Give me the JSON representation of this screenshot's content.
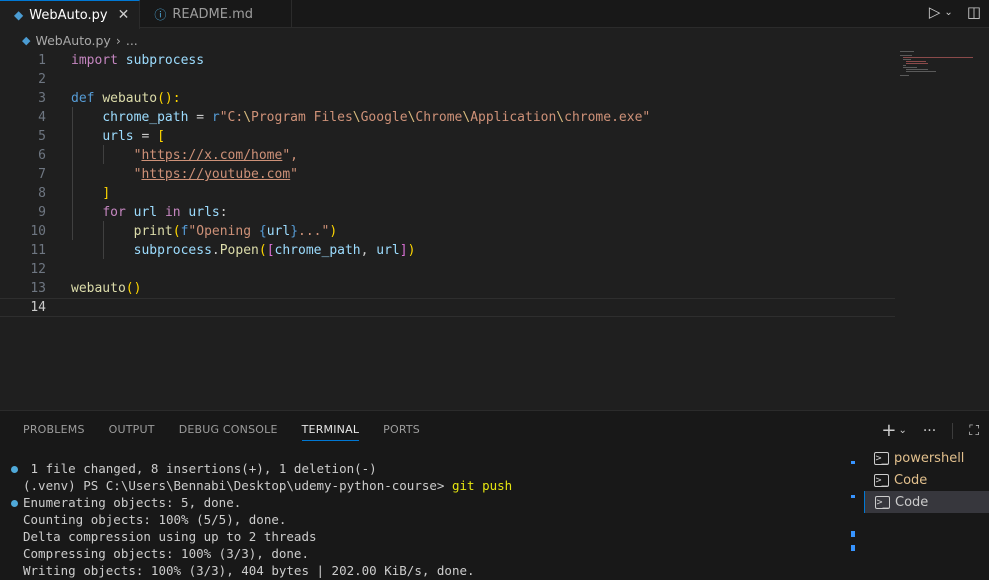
{
  "tabs": [
    {
      "label": "WebAuto.py",
      "active": true
    },
    {
      "label": "README.md",
      "active": false
    }
  ],
  "breadcrumb": {
    "file": "WebAuto.py",
    "more": "..."
  },
  "editor": {
    "current_line": 14,
    "line_numbers": [
      "1",
      "2",
      "3",
      "4",
      "5",
      "6",
      "7",
      "8",
      "9",
      "10",
      "11",
      "12",
      "13",
      "14"
    ]
  },
  "code": {
    "l1_import": "import",
    "l1_module": "subprocess",
    "l3_def": "def",
    "l3_name": "webauto",
    "l3_paren": "():",
    "l4_var": "chrome_path",
    "l4_eq": " = ",
    "l4_prefix": "r",
    "l4_q1": "\"C:",
    "l4_e1": "\\",
    "l4_p1": "Program Files",
    "l4_e2": "\\",
    "l4_p2": "Google",
    "l4_e3": "\\",
    "l4_p3": "Chrome",
    "l4_e4": "\\",
    "l4_p4": "Application",
    "l4_e5": "\\",
    "l4_p5": "chrome.exe\"",
    "l5_var": "urls",
    "l5_eq": " = ",
    "l5_open": "[",
    "l6_q": "\"",
    "l6_url": "https://x.com/home",
    "l6_end": "\",",
    "l7_q": "\"",
    "l7_url": "https://youtube.com",
    "l7_end": "\"",
    "l8_close": "]",
    "l9_for": "for",
    "l9_url": " url ",
    "l9_in": "in",
    "l9_urls": " urls",
    "l9_colon": ":",
    "l10_print": "print",
    "l10_open": "(",
    "l10_f": "f",
    "l10_s1": "\"Opening ",
    "l10_b1": "{",
    "l10_v": "url",
    "l10_b2": "}",
    "l10_s2": "...\"",
    "l10_close": ")",
    "l11_mod": "subprocess",
    "l11_dot": ".",
    "l11_fn": "Popen",
    "l11_open": "(",
    "l11_lb": "[",
    "l11_a1": "chrome_path",
    "l11_comma": ", ",
    "l11_a2": "url",
    "l11_rb": "]",
    "l11_close": ")",
    "l13_call": "webauto",
    "l13_paren": "()"
  },
  "panel": {
    "tabs": [
      "PROBLEMS",
      "OUTPUT",
      "DEBUG CONSOLE",
      "TERMINAL",
      "PORTS"
    ],
    "active_tab": "TERMINAL"
  },
  "terminal": {
    "lines": [
      " 1 file changed, 8 insertions(+), 1 deletion(-)",
      "(.venv) PS C:\\Users\\Bennabi\\Desktop\\udemy-python-course> ",
      "Enumerating objects: 5, done.",
      "Counting objects: 100% (5/5), done.",
      "Delta compression using up to 2 threads",
      "Compressing objects: 100% (3/3), done.",
      "Writing objects: 100% (3/3), 404 bytes | 202.00 KiB/s, done."
    ],
    "command": "git push"
  },
  "terminal_list": [
    {
      "label": "powershell",
      "active": false
    },
    {
      "label": "Code",
      "active": false
    },
    {
      "label": "Code",
      "active": true
    }
  ],
  "colors": {
    "accent": "#0078d4",
    "background": "#1f1f1f",
    "panel": "#181818"
  }
}
